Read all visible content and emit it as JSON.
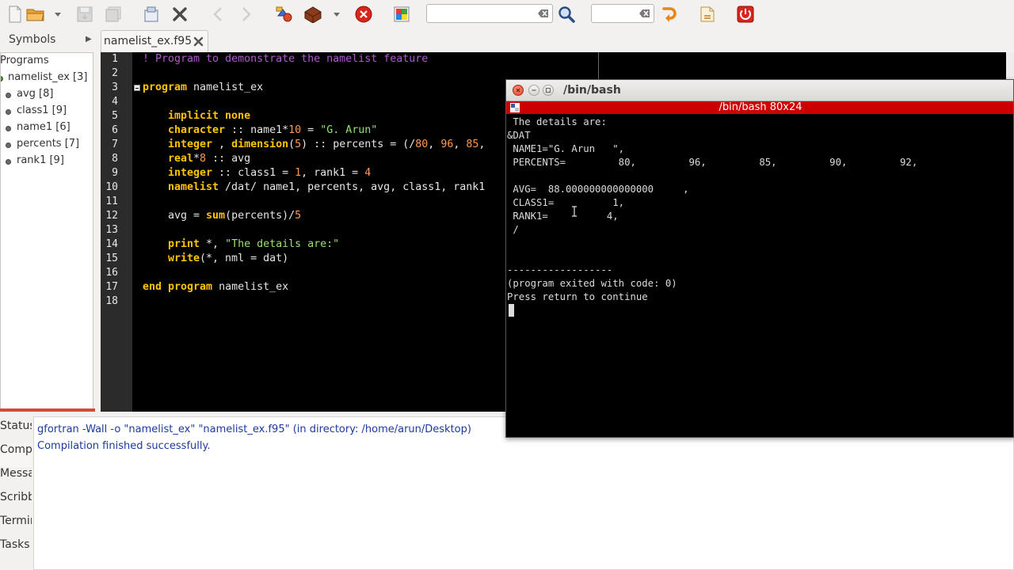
{
  "toolbar": {
    "search_value": "",
    "goto_value": ""
  },
  "sidebar": {
    "tab_label": "Symbols",
    "tree": [
      {
        "label": "Programs",
        "level": "root"
      },
      {
        "label": "namelist_ex [3]",
        "level": "program"
      },
      {
        "label": "avg [8]",
        "level": "child"
      },
      {
        "label": "class1 [9]",
        "level": "child"
      },
      {
        "label": "name1 [6]",
        "level": "child"
      },
      {
        "label": "percents [7]",
        "level": "child"
      },
      {
        "label": "rank1 [9]",
        "level": "child"
      }
    ]
  },
  "editor": {
    "tab_label": "namelist_ex.f95",
    "line_numbers": [
      "1",
      "2",
      "3",
      "4",
      "5",
      "6",
      "7",
      "8",
      "9",
      "10",
      "11",
      "12",
      "13",
      "14",
      "15",
      "16",
      "17",
      "18"
    ],
    "code": {
      "l1": "! Program to demonstrate the namelist feature",
      "l3_kw": "program",
      "l3_id": " namelist_ex",
      "l5_kw": "implicit none",
      "l6_kw": "character",
      "l6_a": " :: name1",
      "l6_b": "*",
      "l6_c": "10",
      "l6_d": " = ",
      "l6_str": "\"G. Arun\"",
      "l7_kw": "integer",
      "l7_a": " , ",
      "l7_kw2": "dimension",
      "l7_b": "(",
      "l7_c": "5",
      "l7_d": ") :: percents = (/",
      "l7_e": "80",
      "l7_f": ", ",
      "l7_g": "96",
      "l7_h": ", ",
      "l7_i": "85",
      "l7_j": ", ",
      "l8_kw": "real",
      "l8_a": "*",
      "l8_b": "8",
      "l8_c": " :: avg",
      "l9_kw": "integer",
      "l9_a": " :: class1 = ",
      "l9_b": "1",
      "l9_c": ", rank1 = ",
      "l9_d": "4",
      "l10_kw": "namelist",
      "l10_a": " /dat/ name1, percents, avg, class1, rank1",
      "l12_a": "avg = ",
      "l12_kw": "sum",
      "l12_b": "(percents)/",
      "l12_c": "5",
      "l14_kw": "print",
      "l14_a": " *, ",
      "l14_str": "\"The details are:\"",
      "l15_kw": "write",
      "l15_a": "(*, nml = dat)",
      "l17_kw": "end program",
      "l17_id": " namelist_ex"
    }
  },
  "bottom": {
    "tabs": [
      "Status",
      "Compiler",
      "Messages",
      "Scribble",
      "Terminal",
      "Tasks"
    ],
    "messages": [
      "gfortran -Wall -o \"namelist_ex\" \"namelist_ex.f95\" (in directory: /home/arun/Desktop)",
      "Compilation finished successfully."
    ]
  },
  "terminal": {
    "window_title": "/bin/bash",
    "bar_title": "/bin/bash 80x24",
    "lines": [
      " The details are:",
      "&DAT",
      " NAME1=\"G. Arun   \",",
      " PERCENTS=         80,         96,         85,         90,         92,",
      " AVG=  88.000000000000000     ,",
      " CLASS1=          1,",
      " RANK1=          4,",
      " /",
      "------------------",
      "(program exited with code: 0)",
      "Press return to continue"
    ]
  }
}
